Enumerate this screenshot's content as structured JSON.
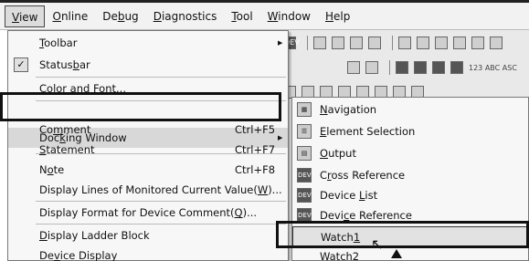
{
  "menubar": {
    "items": [
      {
        "label": "View",
        "mnemonic": "V",
        "rest": "iew",
        "active": true
      },
      {
        "label": "Online",
        "mnemonic": "O",
        "rest": "nline"
      },
      {
        "label": "Debug",
        "pre": "De",
        "mnemonic": "b",
        "rest": "ug"
      },
      {
        "label": "Diagnostics",
        "mnemonic": "D",
        "rest": "iagnostics"
      },
      {
        "label": "Tool",
        "mnemonic": "T",
        "rest": "ool"
      },
      {
        "label": "Window",
        "mnemonic": "W",
        "rest": "indow"
      },
      {
        "label": "Help",
        "mnemonic": "H",
        "rest": "elp"
      }
    ]
  },
  "view_menu": {
    "items": [
      {
        "label": "Toolbar",
        "has_submenu": true
      },
      {
        "label": "Statusbar",
        "checked": true
      },
      {
        "label": "Color and Font..."
      },
      {
        "label": "Docking Window",
        "has_submenu": true,
        "highlighted": true
      },
      {
        "label": "Comment",
        "shortcut": "Ctrl+F5"
      },
      {
        "label": "Statement",
        "shortcut": "Ctrl+F7"
      },
      {
        "label": "Note",
        "shortcut": "Ctrl+F8"
      },
      {
        "label": "Display Lines of Monitored Current Value(W)..."
      },
      {
        "label": "Display Format for Device Comment(Q)..."
      },
      {
        "label": "Display Ladder Block"
      },
      {
        "label": "Device Display"
      }
    ]
  },
  "docking_submenu": {
    "items": [
      {
        "label": "Navigation",
        "icon": "navigation-icon"
      },
      {
        "label": "Element Selection",
        "icon": "element-selection-icon"
      },
      {
        "label": "Output",
        "icon": "output-icon"
      },
      {
        "label": "Cross Reference",
        "icon": "cross-reference-icon"
      },
      {
        "label": "Device List",
        "icon": "device-list-icon"
      },
      {
        "label": "Device Reference",
        "icon": "device-reference-icon"
      },
      {
        "label": "Watch1",
        "highlighted": true
      },
      {
        "label": "Watch2"
      }
    ]
  },
  "toolbar_glyphs": {
    "row2_text": "123 ABC ASC",
    "device_icon_text": "DEV"
  }
}
